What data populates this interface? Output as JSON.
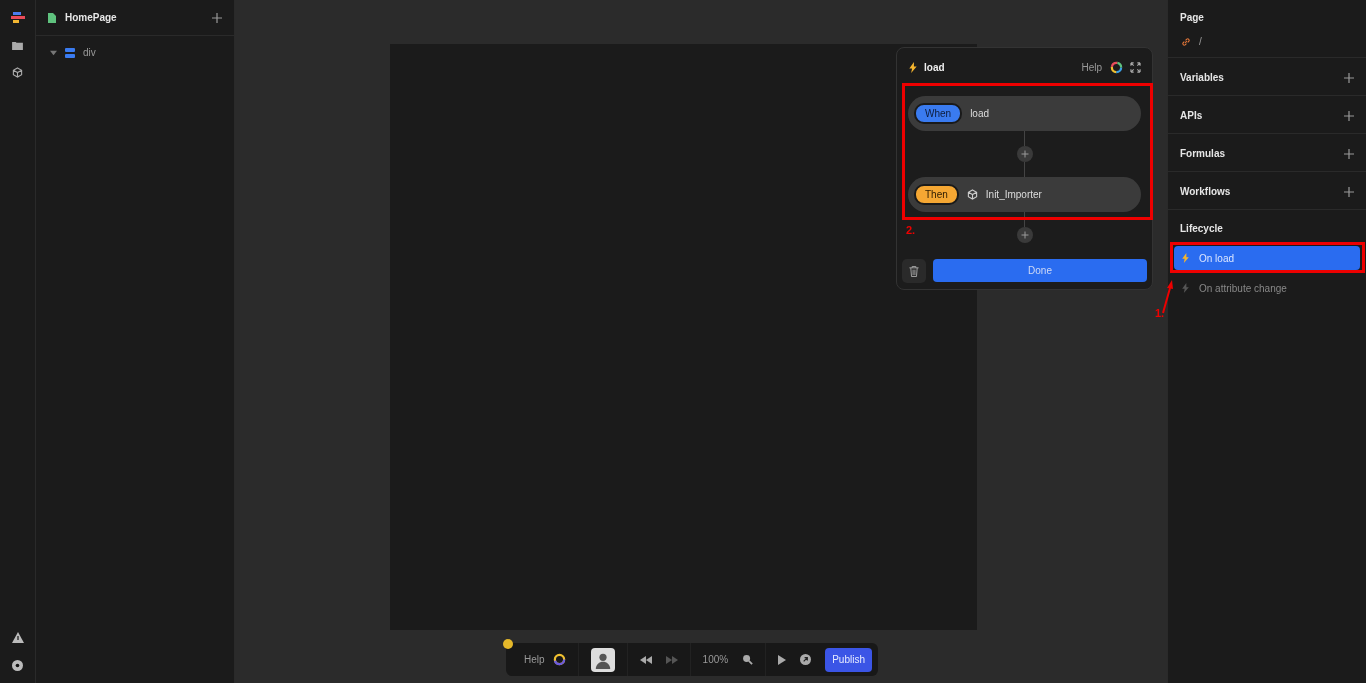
{
  "left_panel": {
    "page": "HomePage",
    "tree": [
      {
        "label": "div",
        "expanded": true
      }
    ]
  },
  "workflow_popup": {
    "title": "load",
    "help": "Help",
    "steps": [
      {
        "kind": "when",
        "badge": "When",
        "label": "load"
      },
      {
        "kind": "then",
        "badge": "Then",
        "label": "Init_Importer"
      }
    ],
    "done": "Done"
  },
  "right_panel": {
    "page_heading": "Page",
    "page_path": "/",
    "sections": [
      "Variables",
      "APIs",
      "Formulas",
      "Workflows"
    ],
    "lifecycle_heading": "Lifecycle",
    "lifecycle": [
      {
        "label": "On load",
        "selected": true
      },
      {
        "label": "On attribute change",
        "selected": false
      }
    ]
  },
  "toolbar": {
    "help": "Help",
    "zoom": "100%",
    "publish": "Publish"
  },
  "annotations": [
    {
      "label": "1."
    },
    {
      "label": "2."
    }
  ]
}
